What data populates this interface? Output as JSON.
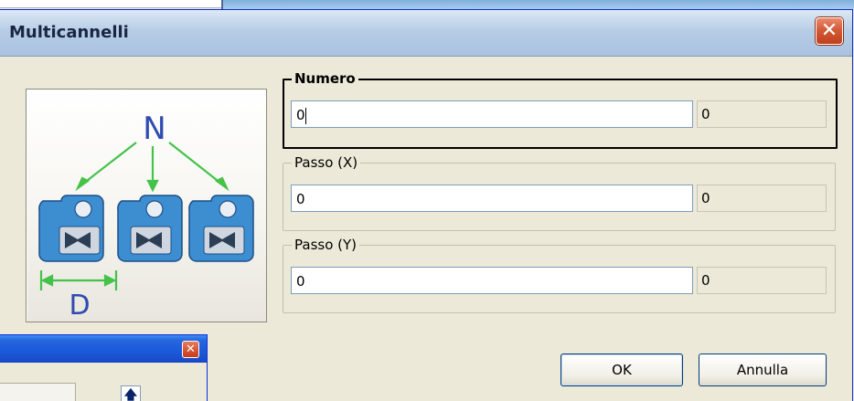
{
  "dialog": {
    "title": "Multicannelli",
    "close_icon": "close-icon"
  },
  "illustration": {
    "label_n": "N",
    "label_d": "D",
    "colors": {
      "arrow": "#45c24a",
      "text": "#2f4ab0",
      "body": "#3d8ed1"
    }
  },
  "groups": [
    {
      "label": "Numero",
      "value": "0",
      "readout": "0",
      "active": true
    },
    {
      "label": "Passo (X)",
      "value": "0",
      "readout": "0",
      "active": false
    },
    {
      "label": "Passo (Y)",
      "value": "0",
      "readout": "0",
      "active": false
    }
  ],
  "buttons": {
    "ok": "OK",
    "cancel": "Annulla"
  },
  "background_window": {
    "close_icon": "close-icon",
    "arrow_icon": "up-arrow-icon"
  }
}
